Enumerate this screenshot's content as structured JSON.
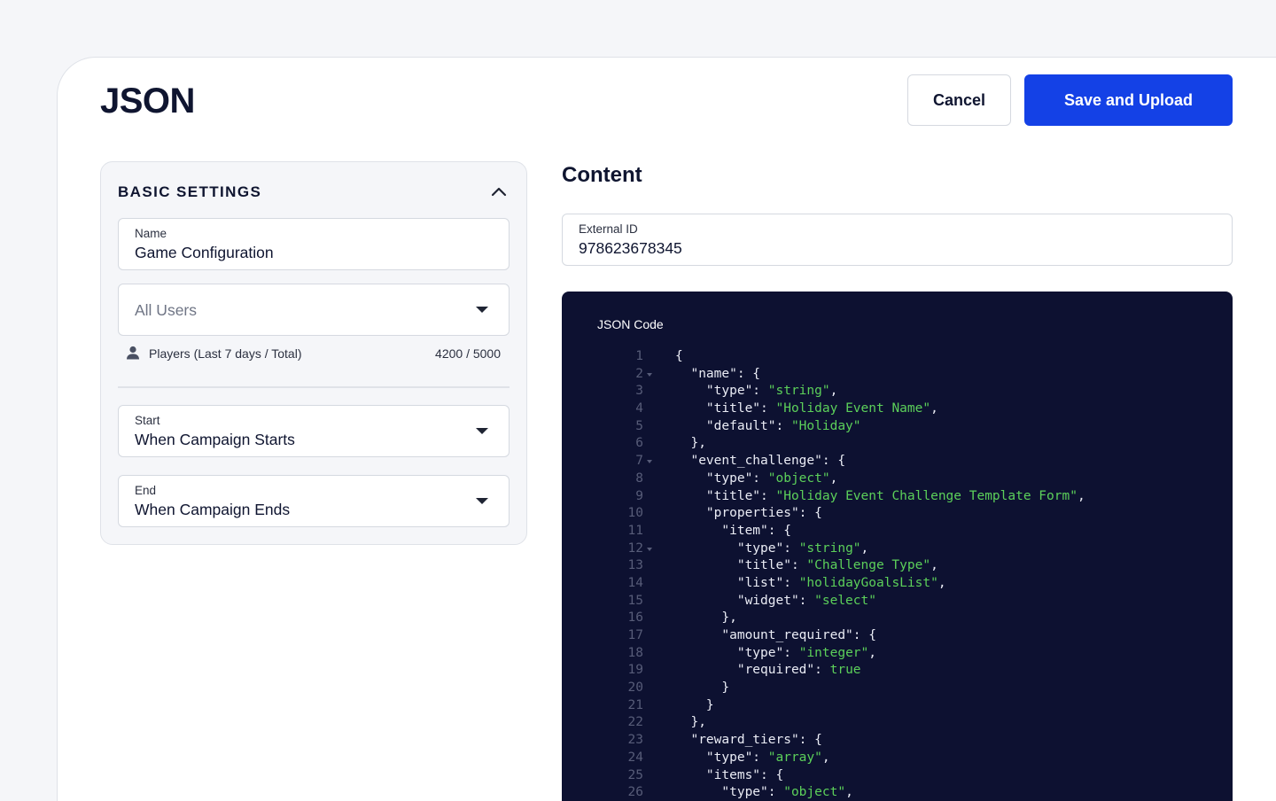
{
  "header": {
    "title": "JSON",
    "cancel_label": "Cancel",
    "save_label": "Save and Upload"
  },
  "settings": {
    "title": "BASIC SETTINGS",
    "name_field": {
      "label": "Name",
      "value": "Game Configuration"
    },
    "audience_select": {
      "placeholder": "All Users"
    },
    "players": {
      "label": "Players (Last 7 days / Total)",
      "count": "4200 / 5000"
    },
    "start_field": {
      "label": "Start",
      "value": "When Campaign Starts"
    },
    "end_field": {
      "label": "End",
      "value": "When Campaign Ends"
    }
  },
  "content": {
    "title": "Content",
    "external_id": {
      "label": "External ID",
      "value": "978623678345"
    },
    "code_panel": {
      "title": "JSON Code",
      "lines": [
        {
          "n": "1",
          "fold": false,
          "segments": [
            {
              "t": "{",
              "k": "p"
            }
          ]
        },
        {
          "n": "2",
          "fold": true,
          "segments": [
            {
              "t": "  \"name\": {",
              "k": "p"
            }
          ]
        },
        {
          "n": "3",
          "fold": false,
          "segments": [
            {
              "t": "    \"type\": ",
              "k": "p"
            },
            {
              "t": "\"string\"",
              "k": "s"
            },
            {
              "t": ",",
              "k": "p"
            }
          ]
        },
        {
          "n": "4",
          "fold": false,
          "segments": [
            {
              "t": "    \"title\": ",
              "k": "p"
            },
            {
              "t": "\"Holiday Event Name\"",
              "k": "s"
            },
            {
              "t": ",",
              "k": "p"
            }
          ]
        },
        {
          "n": "5",
          "fold": false,
          "segments": [
            {
              "t": "    \"default\": ",
              "k": "p"
            },
            {
              "t": "\"Holiday\"",
              "k": "s"
            }
          ]
        },
        {
          "n": "6",
          "fold": false,
          "segments": [
            {
              "t": "  },",
              "k": "p"
            }
          ]
        },
        {
          "n": "7",
          "fold": true,
          "segments": [
            {
              "t": "  \"event_challenge\": {",
              "k": "p"
            }
          ]
        },
        {
          "n": "8",
          "fold": false,
          "segments": [
            {
              "t": "    \"type\": ",
              "k": "p"
            },
            {
              "t": "\"object\"",
              "k": "s"
            },
            {
              "t": ",",
              "k": "p"
            }
          ]
        },
        {
          "n": "9",
          "fold": false,
          "segments": [
            {
              "t": "    \"title\": ",
              "k": "p"
            },
            {
              "t": "\"Holiday Event Challenge Template Form\"",
              "k": "s"
            },
            {
              "t": ",",
              "k": "p"
            }
          ]
        },
        {
          "n": "10",
          "fold": false,
          "segments": [
            {
              "t": "    \"properties\": {",
              "k": "p"
            }
          ]
        },
        {
          "n": "11",
          "fold": false,
          "segments": [
            {
              "t": "      \"item\": {",
              "k": "p"
            }
          ]
        },
        {
          "n": "12",
          "fold": true,
          "segments": [
            {
              "t": "        \"type\": ",
              "k": "p"
            },
            {
              "t": "\"string\"",
              "k": "s"
            },
            {
              "t": ",",
              "k": "p"
            }
          ]
        },
        {
          "n": "13",
          "fold": false,
          "segments": [
            {
              "t": "        \"title\": ",
              "k": "p"
            },
            {
              "t": "\"Challenge Type\"",
              "k": "s"
            },
            {
              "t": ",",
              "k": "p"
            }
          ]
        },
        {
          "n": "14",
          "fold": false,
          "segments": [
            {
              "t": "        \"list\": ",
              "k": "p"
            },
            {
              "t": "\"holidayGoalsList\"",
              "k": "s"
            },
            {
              "t": ",",
              "k": "p"
            }
          ]
        },
        {
          "n": "15",
          "fold": false,
          "segments": [
            {
              "t": "        \"widget\": ",
              "k": "p"
            },
            {
              "t": "\"select\"",
              "k": "s"
            }
          ]
        },
        {
          "n": "16",
          "fold": false,
          "segments": [
            {
              "t": "      },",
              "k": "p"
            }
          ]
        },
        {
          "n": "17",
          "fold": false,
          "segments": [
            {
              "t": "      \"amount_required\": {",
              "k": "p"
            }
          ]
        },
        {
          "n": "18",
          "fold": false,
          "segments": [
            {
              "t": "        \"type\": ",
              "k": "p"
            },
            {
              "t": "\"integer\"",
              "k": "s"
            },
            {
              "t": ",",
              "k": "p"
            }
          ]
        },
        {
          "n": "19",
          "fold": false,
          "segments": [
            {
              "t": "        \"required\": ",
              "k": "p"
            },
            {
              "t": "true",
              "k": "b"
            }
          ]
        },
        {
          "n": "20",
          "fold": false,
          "segments": [
            {
              "t": "      }",
              "k": "p"
            }
          ]
        },
        {
          "n": "21",
          "fold": false,
          "segments": [
            {
              "t": "    }",
              "k": "p"
            }
          ]
        },
        {
          "n": "22",
          "fold": false,
          "segments": [
            {
              "t": "  },",
              "k": "p"
            }
          ]
        },
        {
          "n": "23",
          "fold": false,
          "segments": [
            {
              "t": "  \"reward_tiers\": {",
              "k": "p"
            }
          ]
        },
        {
          "n": "24",
          "fold": false,
          "segments": [
            {
              "t": "    \"type\": ",
              "k": "p"
            },
            {
              "t": "\"array\"",
              "k": "s"
            },
            {
              "t": ",",
              "k": "p"
            }
          ]
        },
        {
          "n": "25",
          "fold": false,
          "segments": [
            {
              "t": "    \"items\": {",
              "k": "p"
            }
          ]
        },
        {
          "n": "26",
          "fold": false,
          "segments": [
            {
              "t": "      \"type\": ",
              "k": "p"
            },
            {
              "t": "\"object\"",
              "k": "s"
            },
            {
              "t": ",",
              "k": "p"
            }
          ]
        }
      ]
    }
  },
  "icons": {
    "collapse": "chevron-up-icon",
    "dropdown": "caret-down-icon",
    "players": "user-icon",
    "fold": "fold-arrow-icon"
  },
  "colors": {
    "primary": "#1441e6",
    "code_background": "#0d1131",
    "code_string": "#5cd05a",
    "code_line_number": "#575c78"
  }
}
